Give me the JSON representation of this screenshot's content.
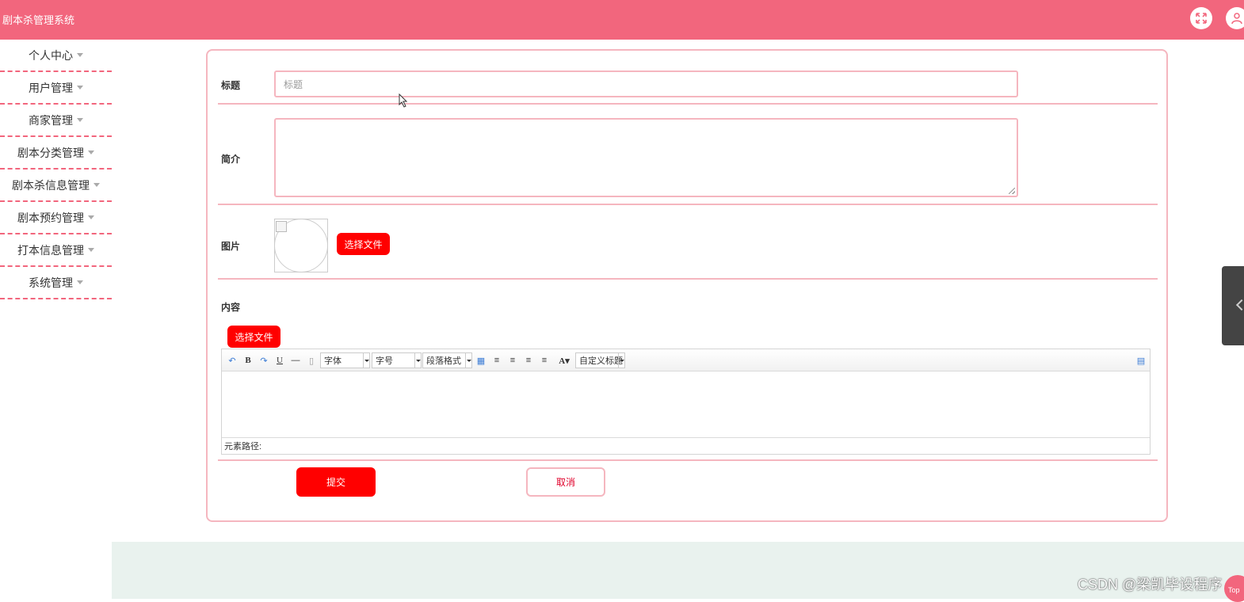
{
  "app": {
    "title": "剧本杀管理系统"
  },
  "header_icons": [
    "fullscreen-icon",
    "user-icon"
  ],
  "sidebar": {
    "items": [
      {
        "label": "个人中心"
      },
      {
        "label": "用户管理"
      },
      {
        "label": "商家管理"
      },
      {
        "label": "剧本分类管理"
      },
      {
        "label": "剧本杀信息管理"
      },
      {
        "label": "剧本预约管理"
      },
      {
        "label": "打本信息管理"
      },
      {
        "label": "系统管理"
      }
    ]
  },
  "form": {
    "title_label": "标题",
    "title_placeholder": "标题",
    "title_value": "",
    "intro_label": "简介",
    "intro_value": "",
    "image_label": "图片",
    "image_upload_label": "选择文件",
    "content_label": "内容",
    "content_upload_label": "选择文件",
    "editor": {
      "font_select": "字体",
      "size_select": "字号",
      "paragraph_select": "段落格式",
      "custom_title_select": "自定义标题",
      "path_label": "元素路径:"
    },
    "submit_label": "提交",
    "cancel_label": "取消"
  },
  "footer": {
    "watermark": "CSDN @梁凯毕设程序",
    "top_button": "Top"
  },
  "colors": {
    "header": "#f2667d",
    "accent_red": "#ff0000",
    "border_pink": "#f5b6bf",
    "footer_bg": "#e9f2ee"
  }
}
